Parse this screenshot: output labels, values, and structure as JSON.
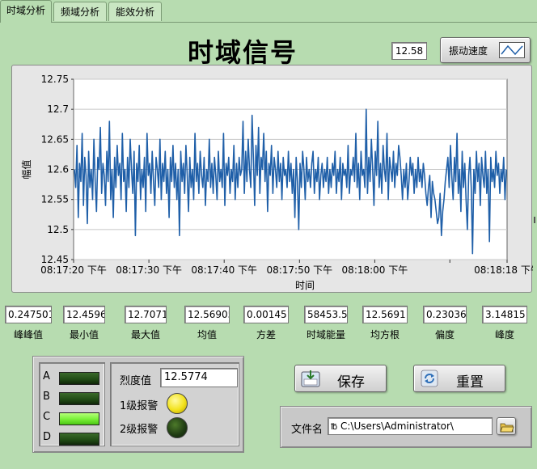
{
  "tabs": [
    {
      "label": "时域分析",
      "active": true
    },
    {
      "label": "频域分析",
      "active": false
    },
    {
      "label": "能效分析",
      "active": false
    }
  ],
  "header": {
    "title": "时域信号",
    "value_display": "12.58",
    "speed_button_label": "振动速度"
  },
  "chart_data": {
    "type": "line",
    "title": "",
    "xlabel": "时间",
    "ylabel": "幅值",
    "ylim": [
      12.45,
      12.75
    ],
    "yticks": [
      "12.75",
      "12.7",
      "12.65",
      "12.6",
      "12.55",
      "12.5",
      "12.45"
    ],
    "xticks": [
      "08:17:20 下午",
      "08:17:30 下午",
      "08:17:40 下午",
      "08:17:50 下午",
      "08:18:00 下午",
      "08:18:18 下午"
    ],
    "grid": true,
    "color": "#1f5fa8",
    "series": [
      {
        "values": [
          12.6,
          12.57,
          12.64,
          12.52,
          12.61,
          12.58,
          12.66,
          12.54,
          12.62,
          12.59,
          12.51,
          12.63,
          12.57,
          12.6,
          12.55,
          12.65,
          12.58,
          12.53,
          12.62,
          12.6,
          12.67,
          12.56,
          12.61,
          12.59,
          12.54,
          12.63,
          12.58,
          12.68,
          12.55,
          12.6,
          12.52,
          12.62,
          12.57,
          12.64,
          12.59,
          12.61,
          12.55,
          12.66,
          12.58,
          12.6,
          12.53,
          12.62,
          12.57,
          12.65,
          12.6,
          12.56,
          12.63,
          12.49,
          12.61,
          12.58,
          12.64,
          12.55,
          12.6,
          12.57,
          12.62,
          12.53,
          12.66,
          12.59,
          12.61,
          12.56,
          12.63,
          12.58,
          12.54,
          12.62,
          12.6,
          12.57,
          12.65,
          12.55,
          12.61,
          12.58,
          12.63,
          12.56,
          12.6,
          12.52,
          12.62,
          12.58,
          12.64,
          12.57,
          12.61,
          12.55,
          12.6,
          12.49,
          12.63,
          12.58,
          12.61,
          12.56,
          12.64,
          12.59,
          12.53,
          12.62,
          12.57,
          12.6,
          12.55,
          12.66,
          12.58,
          12.61,
          12.56,
          12.63,
          12.59,
          12.57,
          12.62,
          12.54,
          12.6,
          12.58,
          12.65,
          12.57,
          12.61,
          12.56,
          12.62,
          12.59,
          12.55,
          12.63,
          12.58,
          12.6,
          12.57,
          12.66,
          12.54,
          12.61,
          12.59,
          12.62,
          12.56,
          12.6,
          12.58,
          12.64,
          12.55,
          12.61,
          12.57,
          12.62,
          12.59,
          12.6,
          12.68,
          12.56,
          12.63,
          12.58,
          12.65,
          12.6,
          12.57,
          12.69,
          12.62,
          12.54,
          12.64,
          12.59,
          12.67,
          12.56,
          12.62,
          12.6,
          12.66,
          12.58,
          12.63,
          12.53,
          12.61,
          12.59,
          12.64,
          12.56,
          12.62,
          12.6,
          12.57,
          12.63,
          12.58,
          12.61,
          12.55,
          12.62,
          12.59,
          12.6,
          12.57,
          12.63,
          12.58,
          12.61,
          12.56,
          12.6,
          12.52,
          12.62,
          12.58,
          12.5,
          12.61,
          12.57,
          12.63,
          12.6,
          12.55,
          12.62,
          12.58,
          12.6,
          12.57,
          12.61,
          12.63,
          12.56,
          12.6,
          12.58,
          12.62,
          12.55,
          12.59,
          12.61,
          12.57,
          12.6,
          12.58,
          12.62,
          12.56,
          12.6,
          12.57,
          12.61,
          12.59,
          12.63,
          12.56,
          12.6,
          12.58,
          12.62,
          12.55,
          12.61,
          12.59,
          12.6,
          12.57,
          12.64,
          12.56,
          12.6,
          12.59,
          12.62,
          12.58,
          12.66,
          12.57,
          12.61,
          12.55,
          12.63,
          12.59,
          12.6,
          12.57,
          12.7,
          12.56,
          12.62,
          12.58,
          12.65,
          12.6,
          12.54,
          12.63,
          12.59,
          12.68,
          12.57,
          12.61,
          12.56,
          12.64,
          12.6,
          12.58,
          12.66,
          12.55,
          12.62,
          12.6,
          12.58,
          12.63,
          12.57,
          12.61,
          12.59,
          12.64,
          12.62,
          12.59,
          12.55,
          12.6,
          12.57,
          12.61,
          12.55,
          12.58,
          12.62,
          12.59,
          12.61,
          12.56,
          12.6,
          12.57,
          12.62,
          12.58,
          12.6,
          12.57,
          12.61,
          12.59,
          12.56,
          12.54,
          12.57,
          12.59,
          12.52,
          12.58,
          12.56,
          12.55,
          12.53,
          12.51,
          12.52,
          12.56,
          12.49,
          12.53,
          12.55,
          12.58,
          12.6,
          12.62,
          12.57,
          12.64,
          12.59,
          12.55,
          12.62,
          12.58,
          12.66,
          12.56,
          12.6,
          12.53,
          12.63,
          12.57,
          12.61,
          12.55,
          12.5,
          12.59,
          12.62,
          12.57,
          12.46,
          12.6,
          12.56,
          12.63,
          12.58,
          12.61,
          12.54,
          12.62,
          12.59,
          12.57,
          12.63,
          12.56,
          12.6,
          12.48,
          12.62,
          12.58,
          12.6,
          12.57,
          12.63,
          12.59,
          12.61,
          12.56,
          12.6,
          12.58,
          12.62,
          12.55,
          12.6
        ]
      }
    ]
  },
  "stats": [
    {
      "value": "0.247501",
      "label": "峰峰值"
    },
    {
      "value": "12.4596",
      "label": "最小值"
    },
    {
      "value": "12.7071",
      "label": "最大值"
    },
    {
      "value": "12.56905",
      "label": "均值"
    },
    {
      "value": "0.001451",
      "label": "方差"
    },
    {
      "value": "58453.5",
      "label": "时域能量"
    },
    {
      "value": "12.5691",
      "label": "均方根"
    },
    {
      "value": "0.23036",
      "label": "偏度"
    },
    {
      "value": "3.14815",
      "label": "峰度"
    }
  ],
  "leds": [
    {
      "label": "A",
      "on": false
    },
    {
      "label": "B",
      "on": false
    },
    {
      "label": "C",
      "on": true
    },
    {
      "label": "D",
      "on": false
    }
  ],
  "alarm": {
    "intensity_label": "烈度值",
    "intensity_value": "12.5774",
    "level1_label": "1级报警",
    "level1_on": true,
    "level2_label": "2级报警",
    "level2_on": false
  },
  "buttons": {
    "save": "保存",
    "reset": "重置"
  },
  "file": {
    "label": "文件名",
    "path_prefix": "℔",
    "path": "C:\\Users\\Administrator\\"
  },
  "colors": {
    "background": "#b7dcb0",
    "plot_line": "#1f5fa8",
    "led_off": "#1f4a14",
    "led_on": "#7cf23b",
    "alarm_yellow": "#f2e21c",
    "alarm_off": "#1e3a12"
  }
}
